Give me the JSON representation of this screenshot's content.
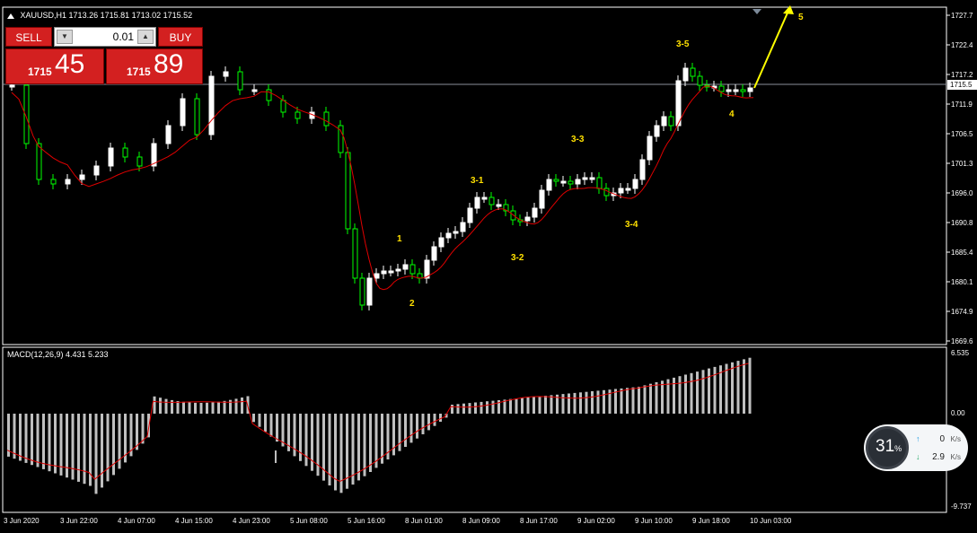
{
  "header": {
    "symbol": "XAUUSD,H1",
    "ohlc": "1713.26 1715.81 1713.02 1715.52"
  },
  "trade_panel": {
    "sell_label": "SELL",
    "buy_label": "BUY",
    "volume": "0.01",
    "sell_price_prefix": "1715",
    "sell_price_big": "45",
    "buy_price_prefix": "1715",
    "buy_price_big": "89",
    "button_color": "#d32020"
  },
  "price_axis": {
    "labels": [
      "1727.7",
      "1722.4",
      "1717.2",
      "1711.9",
      "1706.5",
      "1701.3",
      "1696.0",
      "1690.8",
      "1685.4",
      "1680.1",
      "1674.9",
      "1669.6"
    ],
    "current_price": "1715.5"
  },
  "macd": {
    "label": "MACD(12,26,9) 4.431 5.233",
    "axis_labels": [
      "6.535",
      "0.00",
      "-9.737"
    ]
  },
  "time_axis": {
    "labels": [
      "3 Jun 2020",
      "3 Jun 22:00",
      "4 Jun 07:00",
      "4 Jun 15:00",
      "4 Jun 23:00",
      "5 Jun 08:00",
      "5 Jun 16:00",
      "8 Jun 01:00",
      "8 Jun 09:00",
      "8 Jun 17:00",
      "9 Jun 02:00",
      "9 Jun 10:00",
      "9 Jun 18:00",
      "10 Jun 03:00"
    ]
  },
  "wave_labels": [
    "1",
    "2",
    "3-1",
    "3-2",
    "3-3",
    "3-4",
    "3-5",
    "4",
    "5"
  ],
  "net_widget": {
    "percent": "31",
    "percent_unit": "%",
    "upload": "0",
    "download": "2.9",
    "unit": "K/s"
  },
  "colors": {
    "background": "#000000",
    "bull_candle": "#ffffff",
    "bear_candle": "#00ff00",
    "ma_line": "#e00000",
    "wave_label": "#ffe000",
    "macd_hist": "#c0c0c0"
  }
}
